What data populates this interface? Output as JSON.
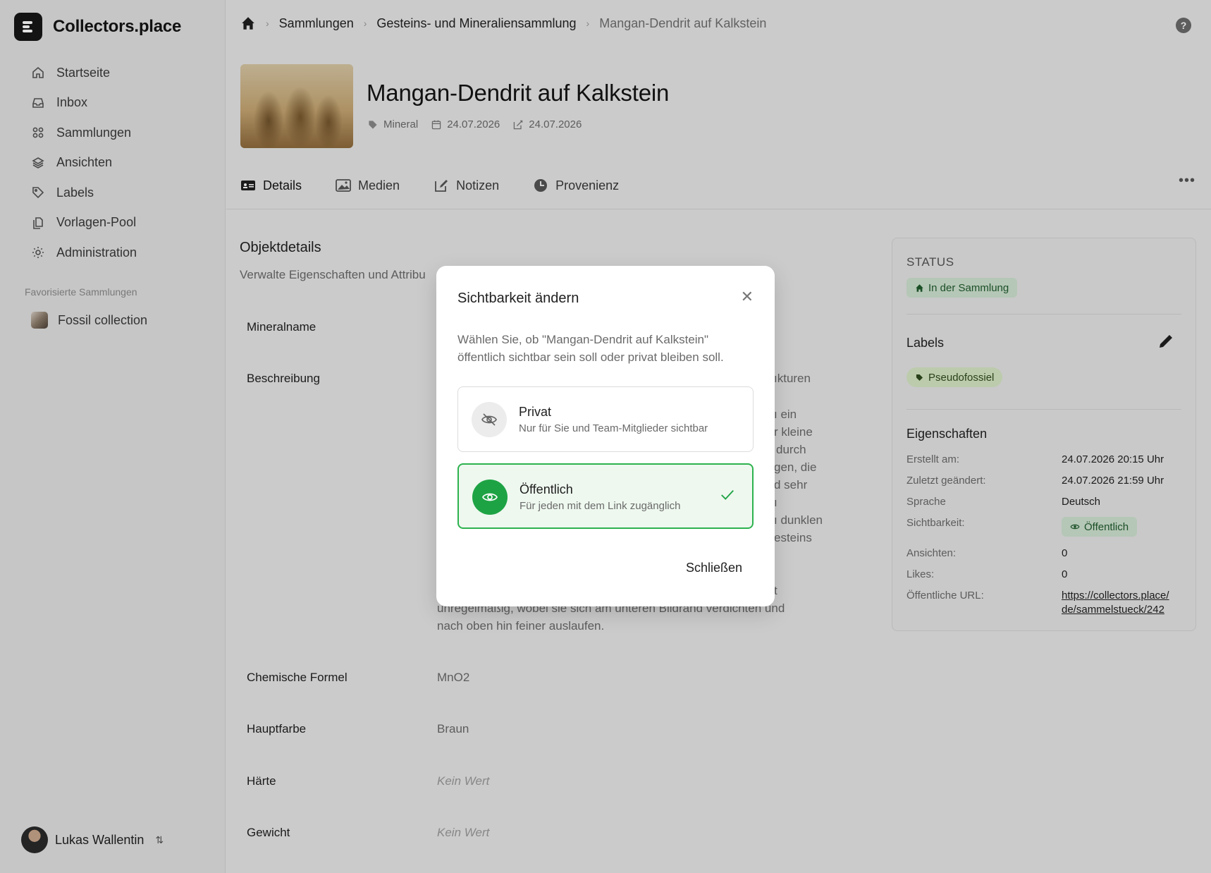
{
  "app": {
    "name": "Collectors.place"
  },
  "sidebar": {
    "items": [
      {
        "label": "Startseite",
        "icon": "home-icon"
      },
      {
        "label": "Inbox",
        "icon": "inbox-icon"
      },
      {
        "label": "Sammlungen",
        "icon": "grid-icon"
      },
      {
        "label": "Ansichten",
        "icon": "layers-icon"
      },
      {
        "label": "Labels",
        "icon": "tag-icon"
      },
      {
        "label": "Vorlagen-Pool",
        "icon": "copy-icon"
      },
      {
        "label": "Administration",
        "icon": "gear-icon"
      }
    ],
    "favorites_heading": "Favorisierte Sammlungen",
    "favorites": [
      {
        "label": "Fossil collection"
      }
    ],
    "user": {
      "name": "Lukas Wallentin"
    }
  },
  "breadcrumb": {
    "items": [
      "Sammlungen",
      "Gesteins- und Mineraliensammlung"
    ],
    "current": "Mangan-Dendrit auf Kalkstein"
  },
  "object": {
    "title": "Mangan-Dendrit auf Kalkstein",
    "category": "Mineral",
    "created": "24.07.2026",
    "modified": "24.07.2026"
  },
  "tabs": [
    {
      "label": "Details",
      "active": true
    },
    {
      "label": "Medien"
    },
    {
      "label": "Notizen"
    },
    {
      "label": "Provenienz"
    }
  ],
  "details": {
    "title": "Objektdetails",
    "subtitle": "Verwalte Eigenschaften und Attribu",
    "fields": {
      "mineralname": {
        "label": "Mineralname"
      },
      "beschreibung": {
        "label": "Beschreibung"
      },
      "formel": {
        "label": "Chemische Formel",
        "value": "MnO2"
      },
      "farbe": {
        "label": "Hauptfarbe",
        "value": "Braun"
      },
      "haerte": {
        "label": "Härte",
        "value": "Kein Wert"
      },
      "gewicht": {
        "label": "Gewicht",
        "value": "Kein Wert"
      }
    },
    "description_fragments": {
      "r1": "ıkturen",
      "r2": "ı ein",
      "r3": "r kleine",
      "r4": "durch",
      "r5": "gen, die",
      "r6": "d sehr",
      "r7": "ı",
      "r8": "ı dunklen",
      "r9": "esteins",
      "r10": "t",
      "l1": "unregelmäßig, wobei sie sich am unteren Bildrand verdichten und",
      "l2": "nach oben hin feiner auslaufen."
    }
  },
  "status_card": {
    "status_heading": "STATUS",
    "status_value": "In der Sammlung",
    "labels_heading": "Labels",
    "label_value": "Pseudofossiel",
    "properties_heading": "Eigenschaften",
    "properties": [
      {
        "key": "Erstellt am:",
        "value": "24.07.2026 20:15 Uhr"
      },
      {
        "key": "Zuletzt geändert:",
        "value": "24.07.2026 21:59 Uhr"
      },
      {
        "key": "Sprache",
        "value": "Deutsch"
      },
      {
        "key": "Sichtbarkeit:",
        "value": "Öffentlich"
      },
      {
        "key": "Ansichten:",
        "value": "0"
      },
      {
        "key": "Likes:",
        "value": "0"
      },
      {
        "key": "Öffentliche URL:",
        "value": "https://collectors.place/de/sammelstueck/242",
        "line1": "https://collectors.place/",
        "line2": "de/sammelstueck/242"
      }
    ]
  },
  "modal": {
    "title": "Sichtbarkeit ändern",
    "text": "Wählen Sie, ob \"Mangan-Dendrit auf Kalkstein\" öffentlich sichtbar sein soll oder privat bleiben soll.",
    "options": [
      {
        "title": "Privat",
        "desc": "Nur für Sie und Team-Mitglieder sichtbar",
        "selected": false
      },
      {
        "title": "Öffentlich",
        "desc": "Für jeden mit dem Link zugänglich",
        "selected": true
      }
    ],
    "close_label": "Schließen"
  },
  "colors": {
    "accent_green": "#1ea344",
    "selected_bg": "#eef8ef",
    "status_pill": "#cfe3d1",
    "label_pill": "#d7e8c4"
  }
}
